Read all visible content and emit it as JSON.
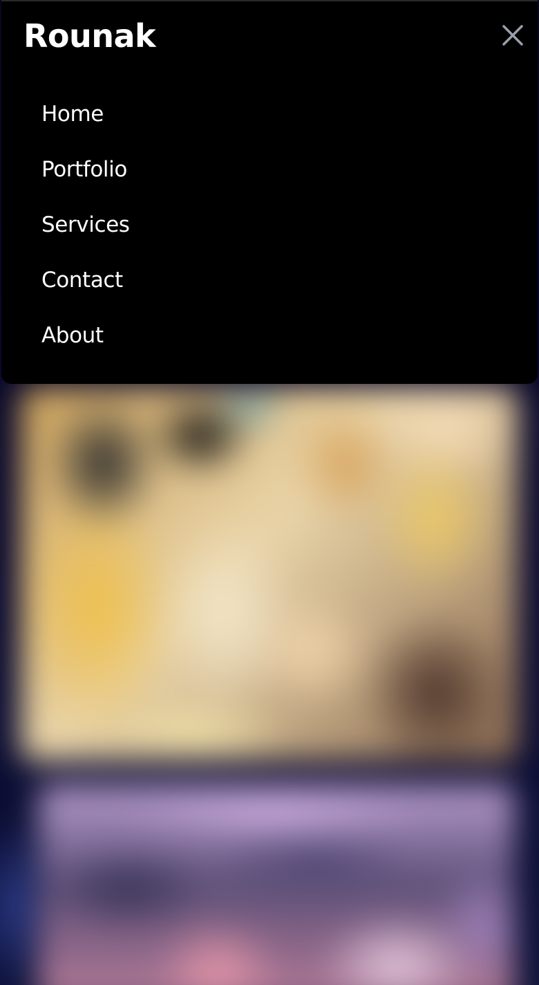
{
  "menu": {
    "brand": "Rounak",
    "close_icon": "close-icon",
    "items": [
      {
        "label": "Home"
      },
      {
        "label": "Portfolio"
      },
      {
        "label": "Services"
      },
      {
        "label": "Contact"
      },
      {
        "label": "About"
      }
    ]
  },
  "colors": {
    "menu_background": "#000000",
    "menu_text": "#ffffff",
    "close_icon": "#9aa0ab",
    "page_background": "#0a0a30"
  }
}
